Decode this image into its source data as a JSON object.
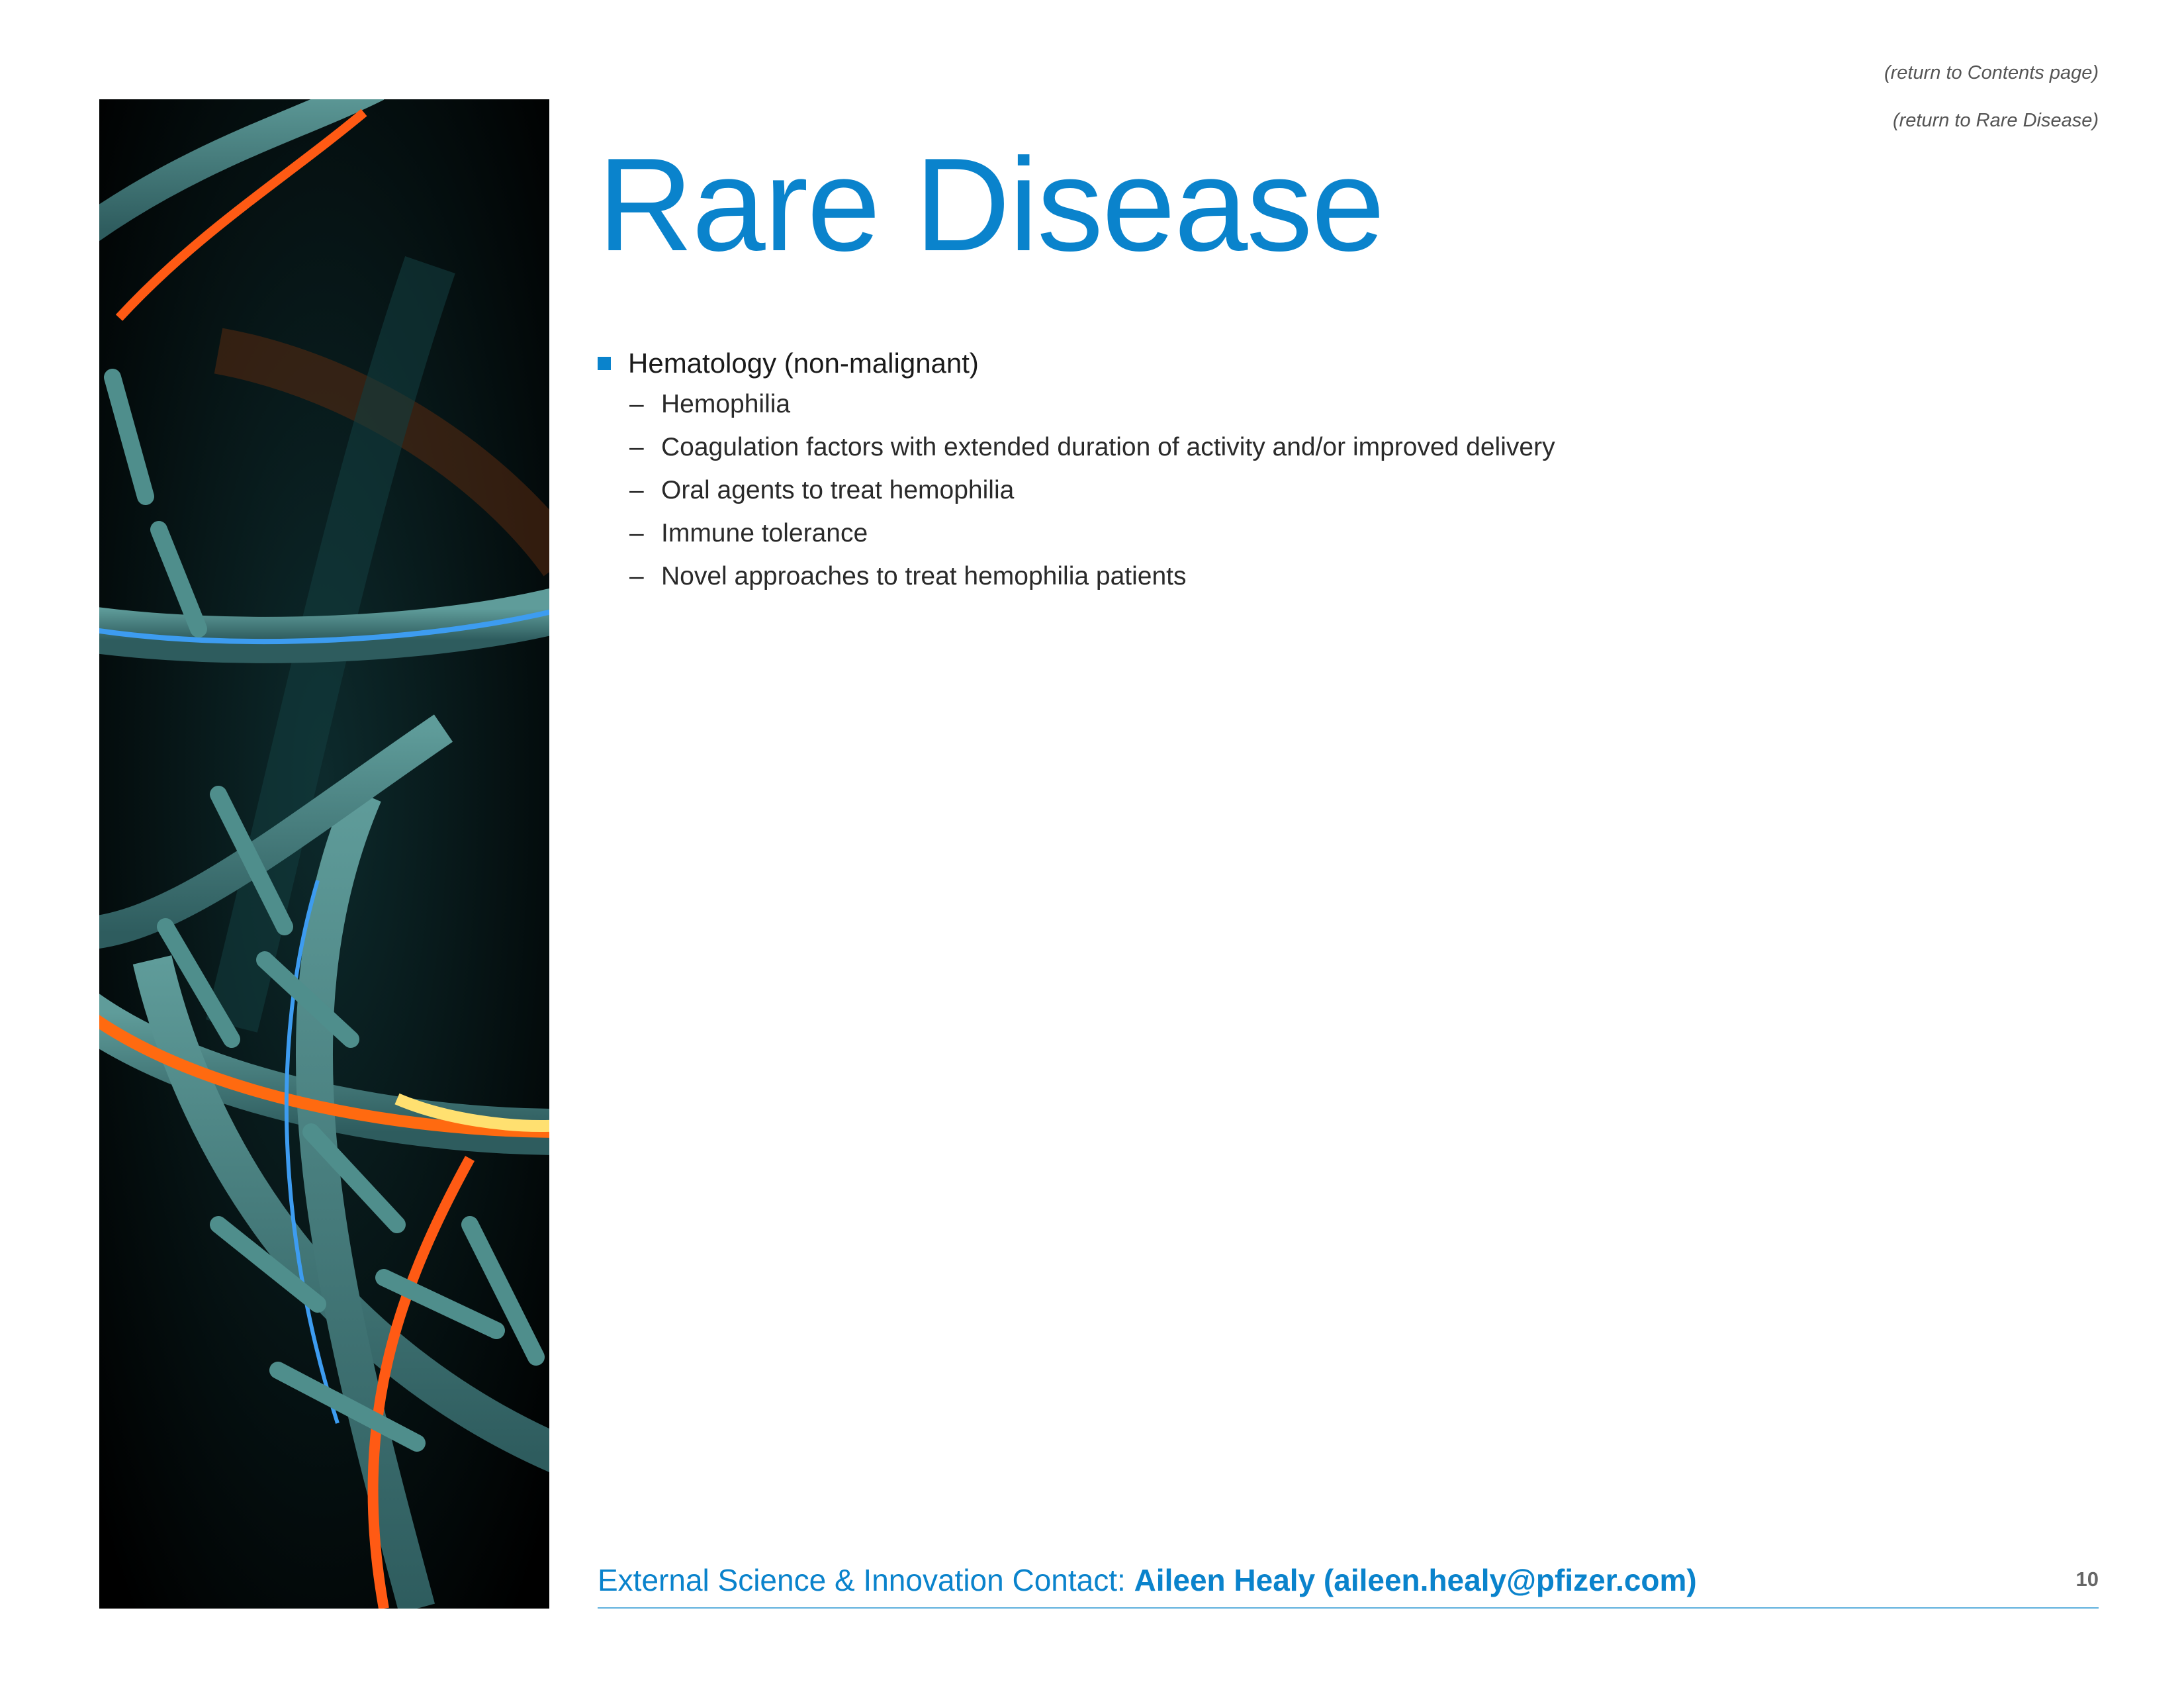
{
  "nav": {
    "return_contents": "(return to Contents page)",
    "return_section": "(return to Rare Disease)"
  },
  "title": "Rare Disease",
  "topics": [
    {
      "label": "Hematology (non-malignant)",
      "subitems": [
        "Hemophilia",
        "Coagulation factors with extended duration of activity and/or improved delivery",
        "Oral agents to treat hemophilia",
        "Immune tolerance",
        "Novel approaches to treat hemophilia patients"
      ]
    }
  ],
  "sub_dash": "–",
  "footer": {
    "contact_prefix": "External Science & Innovation Contact: ",
    "contact_name": "Aileen Healy (aileen.healy@pfizer.com)",
    "page_number": "10"
  },
  "colors": {
    "accent": "#0a83cc",
    "text": "#1a1a1a",
    "muted": "#555555"
  }
}
